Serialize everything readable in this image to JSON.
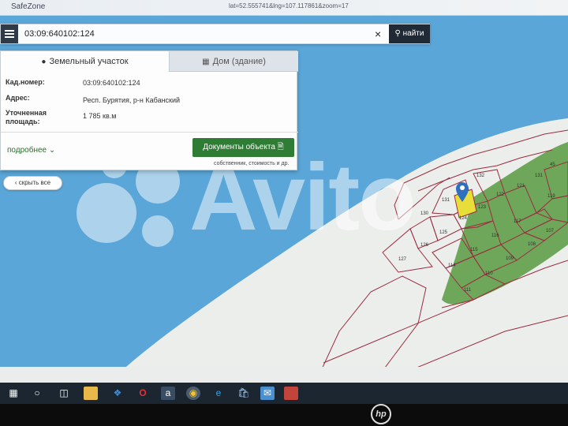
{
  "titlebar": {
    "app_name": "SafeZone",
    "url_fragment": "lat=52.555741&lng=107.117861&zoom=17"
  },
  "search": {
    "value": "03:09:640102:124",
    "button_label": "найти",
    "clear_symbol": "×"
  },
  "panel": {
    "tabs": [
      {
        "label": "Земельный участок"
      },
      {
        "label": "Дом (здание)"
      }
    ],
    "rows": [
      {
        "label": "Кад.номер:",
        "value": "03:09:640102:124"
      },
      {
        "label": "Адрес:",
        "value": "Респ. Бурятия, р-н Кабанский"
      },
      {
        "label": "Уточненная площадь:",
        "value": "1 785 кв.м"
      }
    ],
    "more_link": "подробнее",
    "docs_button": "Документы объекта",
    "docs_note": "собственник, стоимость и др."
  },
  "collapse_all": "скрыть все",
  "watermark": "Avito",
  "map": {
    "parcels": [
      {
        "label": "132"
      },
      {
        "label": "121"
      },
      {
        "label": "131"
      },
      {
        "label": "122"
      },
      {
        "label": "130"
      },
      {
        "label": "124"
      },
      {
        "label": "123"
      },
      {
        "label": "125"
      },
      {
        "label": "116"
      },
      {
        "label": "117"
      },
      {
        "label": "126"
      },
      {
        "label": "115"
      },
      {
        "label": "127"
      },
      {
        "label": "114"
      },
      {
        "label": "110"
      },
      {
        "label": "109"
      },
      {
        "label": "108"
      },
      {
        "label": "107"
      },
      {
        "label": "119"
      },
      {
        "label": "45"
      },
      {
        "label": "111"
      },
      {
        "label": "131"
      }
    ],
    "colors": {
      "water": "#5aa6d8",
      "land": "#eceeec",
      "forest": "#6ea75a",
      "parcel_line": "#9b2d3f",
      "selected": "#e8de3a",
      "marker": "#2f6fc0"
    }
  },
  "taskbar": {
    "icons": [
      "windows-icon",
      "search-icon",
      "task-view-icon",
      "file-explorer-icon",
      "dropbox-icon",
      "opera-icon",
      "amazon-icon",
      "chrome-icon",
      "edge-icon",
      "store-icon",
      "mail-icon",
      "app-icon"
    ]
  },
  "bezel": {
    "logo": "hp"
  }
}
